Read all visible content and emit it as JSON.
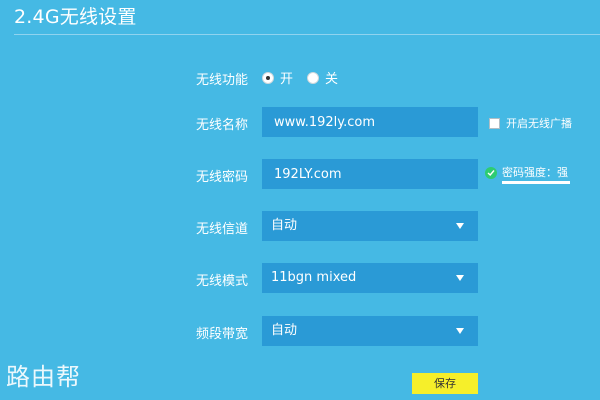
{
  "header": {
    "title": "2.4G无线设置"
  },
  "wireless": {
    "enable_label": "无线功能",
    "options": {
      "on": "开",
      "off": "关"
    },
    "selected": "on"
  },
  "ssid": {
    "label": "无线名称",
    "value": "www.192ly.com",
    "broadcast_label": "开启无线广播",
    "broadcast_checked": false
  },
  "password": {
    "label": "无线密码",
    "value": "192LY.com",
    "strength_text": "密码强度：强"
  },
  "channel": {
    "label": "无线信道",
    "value": "自动"
  },
  "mode": {
    "label": "无线模式",
    "value": "11bgn mixed"
  },
  "bandwidth": {
    "label": "频段带宽",
    "value": "自动"
  },
  "actions": {
    "save_label": "保存"
  },
  "watermark": {
    "text": "路由帮"
  },
  "colors": {
    "background": "#45b9e4",
    "field": "#2a9ad6",
    "save_button": "#f6ef2a",
    "strength_ok": "#2ecc71"
  }
}
